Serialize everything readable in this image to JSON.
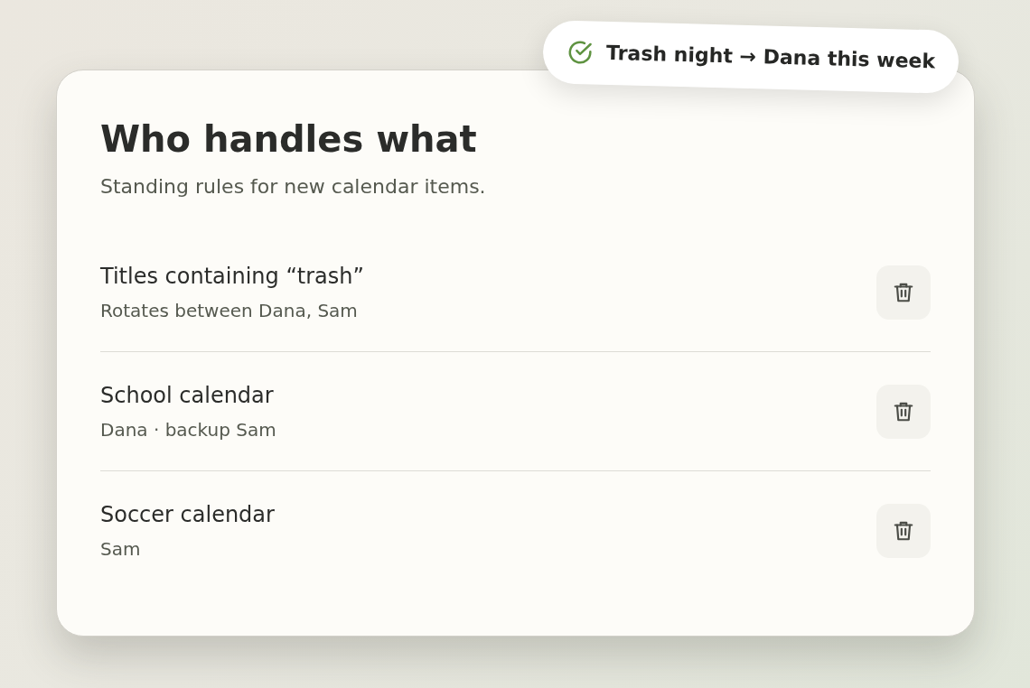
{
  "toast": {
    "text": "Trash night → Dana this week"
  },
  "card": {
    "title": "Who handles what",
    "subtitle": "Standing rules for new calendar items."
  },
  "rules": [
    {
      "title": "Titles containing “trash”",
      "detail": "Rotates between Dana, Sam"
    },
    {
      "title": "School calendar",
      "detail": "Dana · backup Sam"
    },
    {
      "title": "Soccer calendar",
      "detail": "Sam"
    }
  ]
}
